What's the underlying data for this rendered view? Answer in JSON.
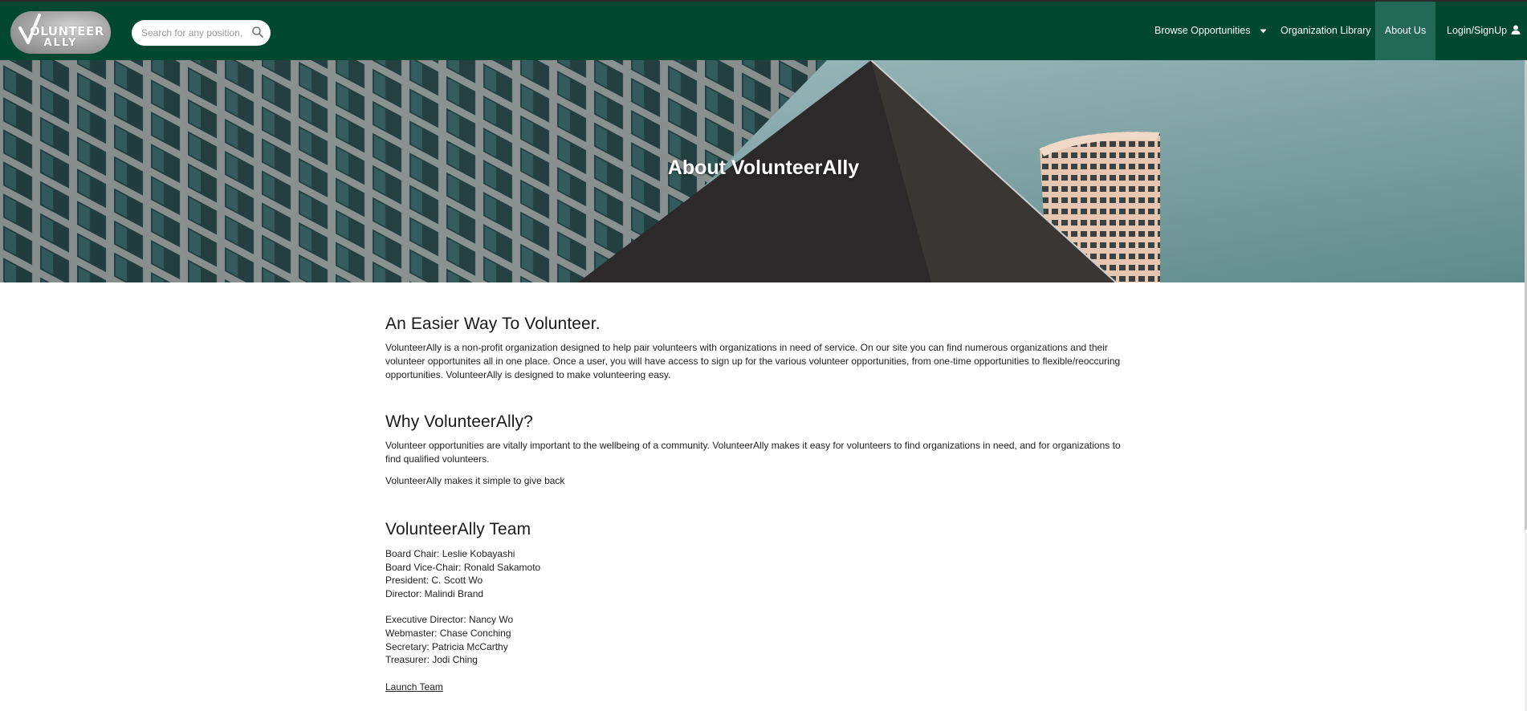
{
  "brand": {
    "logo_line1": "OLUNTEER",
    "logo_line2": "ALLY",
    "logo_icon": "checkmark-v-icon"
  },
  "search": {
    "placeholder": "Search for any position, location or organization",
    "icon": "search-icon"
  },
  "nav": {
    "browse": "Browse Opportunities",
    "browse_icon": "caret-down-icon",
    "library": "Organization Library",
    "about": "About Us",
    "login": "Login/SignUp",
    "login_icon": "user-icon"
  },
  "hero": {
    "title": "About VolunteerAlly"
  },
  "sections": {
    "easier": {
      "heading": "An Easier Way To Volunteer.",
      "body": "VolunteerAlly is a non-profit organization designed to help pair volunteers with organizations in need of service. On our site you can find numerous organizations and their volunteer opportunites all in one place. Once a user, you will have access to sign up for the various volunteer opportunities, from one-time opportunities to flexible/reoccuring opportunities. VolunteerAlly is designed to make volunteering easy."
    },
    "why": {
      "heading": "Why VolunteerAlly?",
      "body1": "Volunteer opportunities are vitally important to the wellbeing of a community. VolunteerAlly makes it easy for volunteers to find organizations in need, and for organizations to find qualified volunteers.",
      "body2": "VolunteerAlly makes it simple to give back"
    },
    "team": {
      "heading": "VolunteerAlly Team",
      "board": [
        "Board Chair: Leslie Kobayashi",
        "Board Vice-Chair: Ronald Sakamoto",
        "President: C. Scott Wo",
        "Director: Malindi Brand"
      ],
      "staff": [
        "Executive Director: Nancy Wo",
        "Webmaster: Chase Conching",
        "Secretary: Patricia McCarthy",
        "Treasurer: Jodi Ching"
      ],
      "launch_link": "Launch Team"
    }
  },
  "colors": {
    "nav_bg": "#004830",
    "nav_active": "#226a55",
    "text": "#222222"
  }
}
